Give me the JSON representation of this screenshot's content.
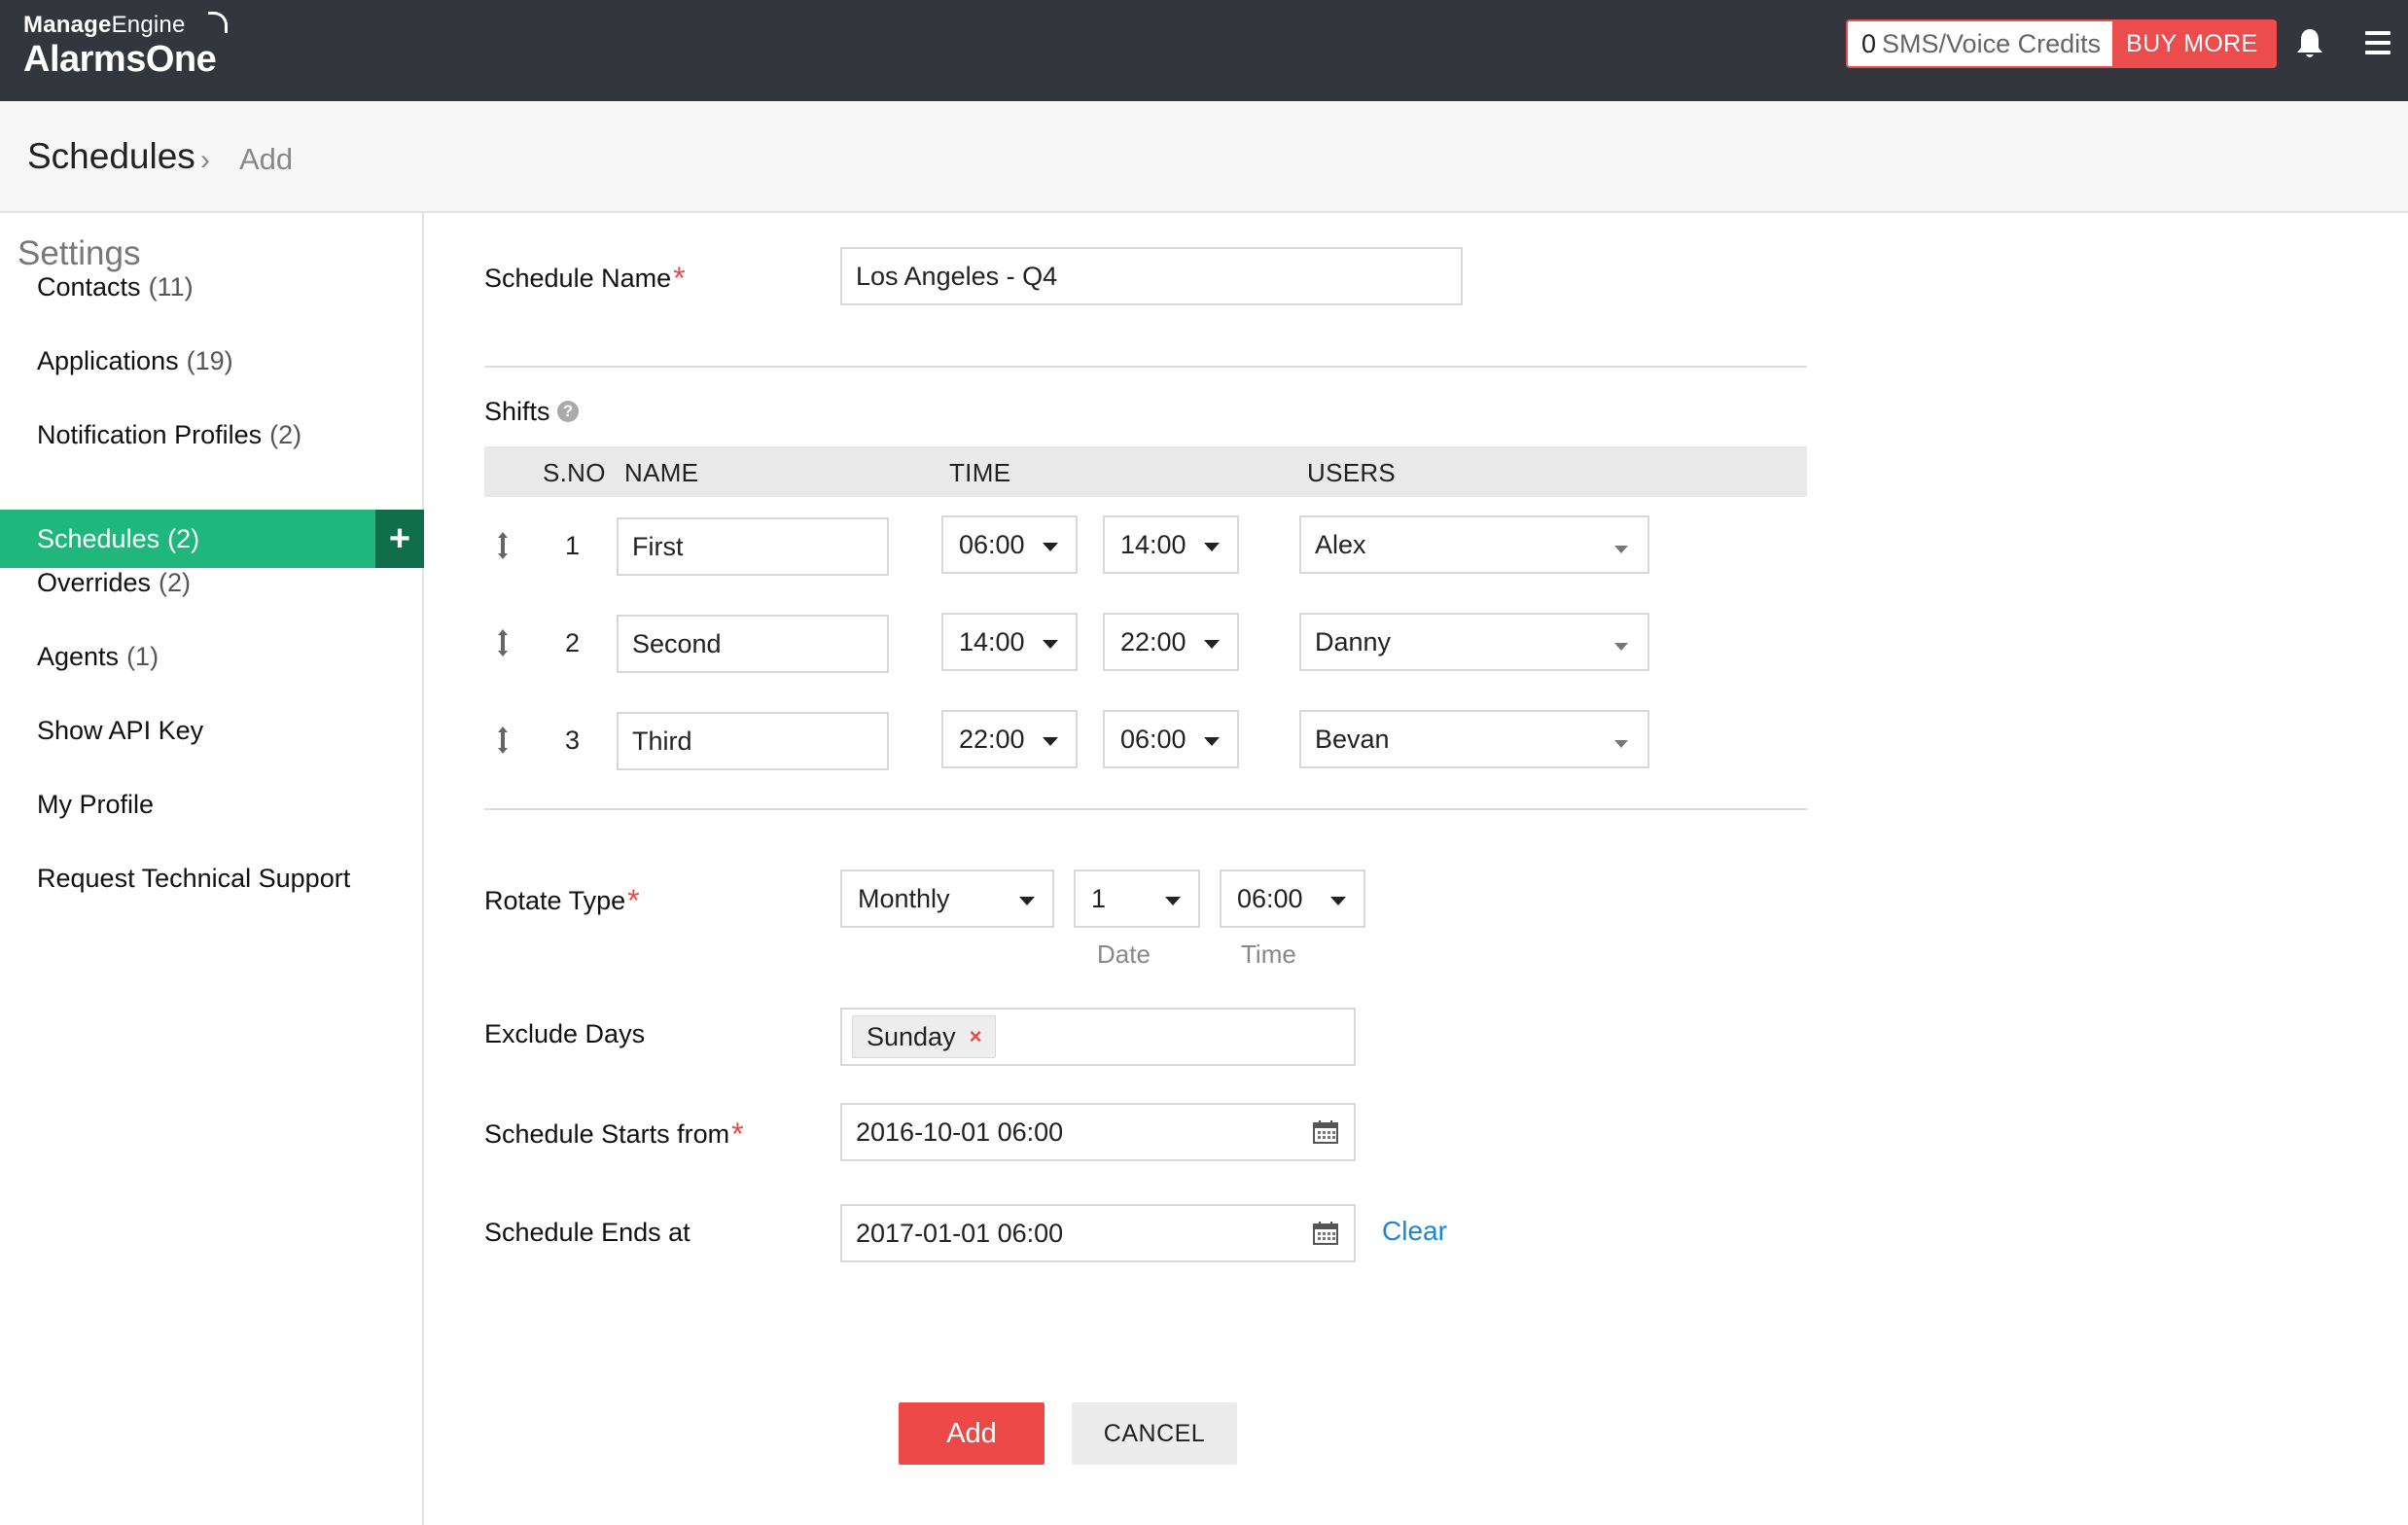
{
  "header": {
    "brand_bold": "Manage",
    "brand_light": "Engine",
    "product": "AlarmsOne",
    "credits_count": "0",
    "credits_label": "SMS/Voice Credits",
    "buy_more": "BUY MORE"
  },
  "breadcrumb": {
    "title": "Schedules",
    "separator": "›",
    "current": "Add"
  },
  "sidebar": {
    "title": "Settings",
    "items": [
      {
        "label": "Contacts",
        "count": "(11)"
      },
      {
        "label": "Applications",
        "count": "(19)"
      },
      {
        "label": "Notification Profiles",
        "count": "(2)"
      },
      {
        "label": "Schedules",
        "count": "(2)"
      },
      {
        "label": "Overrides",
        "count": "(2)"
      },
      {
        "label": "Agents",
        "count": "(1)"
      },
      {
        "label": "Show API Key",
        "count": ""
      },
      {
        "label": "My Profile",
        "count": ""
      },
      {
        "label": "Request Technical Support",
        "count": ""
      }
    ],
    "add_symbol": "+"
  },
  "form": {
    "schedule_name_label": "Schedule Name",
    "schedule_name_value": "Los Angeles - Q4",
    "required_mark": "*",
    "shifts_label": "Shifts",
    "help_symbol": "?",
    "columns": {
      "sno": "S.NO",
      "name": "NAME",
      "time": "TIME",
      "users": "USERS"
    },
    "shifts": [
      {
        "sno": "1",
        "name": "First",
        "start": "06:00",
        "end": "14:00",
        "user": "Alex"
      },
      {
        "sno": "2",
        "name": "Second",
        "start": "14:00",
        "end": "22:00",
        "user": "Danny"
      },
      {
        "sno": "3",
        "name": "Third",
        "start": "22:00",
        "end": "06:00",
        "user": "Bevan"
      }
    ],
    "rotate_type_label": "Rotate Type",
    "rotate_type": "Monthly",
    "rotate_date": "1",
    "rotate_time": "06:00",
    "date_caption": "Date",
    "time_caption": "Time",
    "exclude_days_label": "Exclude Days",
    "exclude_days": [
      "Sunday"
    ],
    "chip_remove": "×",
    "starts_label": "Schedule Starts from",
    "starts_value": "2016-10-01 06:00",
    "ends_label": "Schedule Ends at",
    "ends_value": "2017-01-01 06:00",
    "clear_label": "Clear",
    "add_button": "Add",
    "cancel_button": "CANCEL"
  },
  "colors": {
    "topbar": "#33363c",
    "accent_green": "#1fb77c",
    "danger_red": "#ec4848",
    "link_blue": "#1a86d8"
  }
}
